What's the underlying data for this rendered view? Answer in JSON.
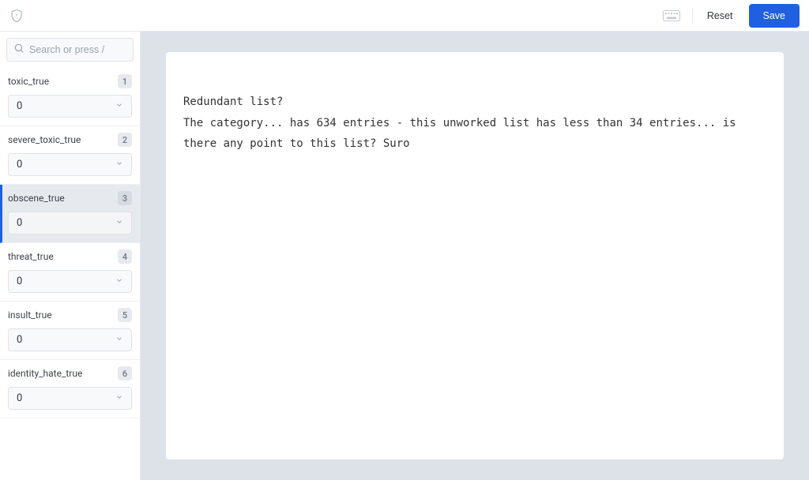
{
  "header": {
    "reset_label": "Reset",
    "save_label": "Save"
  },
  "sidebar": {
    "search_placeholder": "Search or press /",
    "fields": [
      {
        "label": "toxic_true",
        "index": "1",
        "value": "0",
        "selected": false
      },
      {
        "label": "severe_toxic_true",
        "index": "2",
        "value": "0",
        "selected": false
      },
      {
        "label": "obscene_true",
        "index": "3",
        "value": "0",
        "selected": true
      },
      {
        "label": "threat_true",
        "index": "4",
        "value": "0",
        "selected": false
      },
      {
        "label": "insult_true",
        "index": "5",
        "value": "0",
        "selected": false
      },
      {
        "label": "identity_hate_true",
        "index": "6",
        "value": "0",
        "selected": false
      }
    ]
  },
  "main": {
    "content": "Redundant list?\nThe category... has 634 entries - this unworked list has less than 34 entries... is there any point to this list? Suro"
  }
}
